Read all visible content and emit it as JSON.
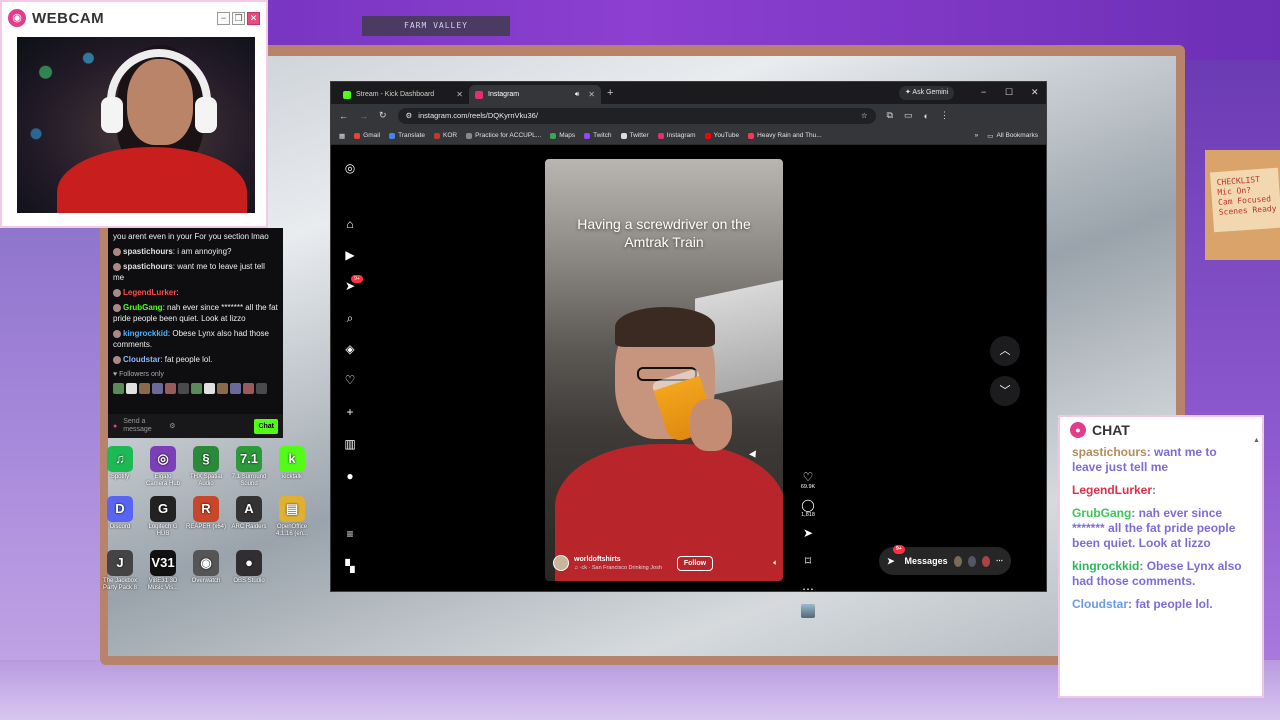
{
  "scene": {
    "sign": "FARM VALLEY",
    "sticky_note": "CHECKLIST\nMic On?\nCam Focused\nScenes Ready"
  },
  "webcam": {
    "title": "WEBCAM",
    "minimize": "−",
    "maximize": "❐",
    "close": "✕"
  },
  "mini_chat": {
    "messages": [
      {
        "user": "",
        "text": "you arent even in your For you section lmao",
        "color": "#ffffff"
      },
      {
        "user": "spastichours",
        "text": ": i am annoying?",
        "color": "#e0e0e0"
      },
      {
        "user": "spastichours",
        "text": ": want me to leave just tell me",
        "color": "#e0e0e0"
      },
      {
        "user": "LegendLurker",
        "text": ":",
        "color": "#ff4a4a"
      },
      {
        "user": "GrubGang",
        "text": ": nah ever since ******* all the fat pride people been quiet. Look at lizzo",
        "color": "#53fc18"
      },
      {
        "user": "kingrockkid",
        "text": ": Obese Lynx also had those comments.",
        "color": "#4ab0ff"
      },
      {
        "user": "Cloudstar",
        "text": ": fat people lol.",
        "color": "#8fb6ff"
      }
    ],
    "followers_only": "♥ Followers only",
    "input_placeholder": "Send a message",
    "chat_button": "Chat"
  },
  "desktop_icons": [
    {
      "label": "Spotify",
      "glyph": "♫",
      "color": "#1db954"
    },
    {
      "label": "Elgato Camera Hub",
      "glyph": "◎",
      "color": "#7b3fb8"
    },
    {
      "label": "THX Spatial Audio",
      "glyph": "§",
      "color": "#2a8a3a"
    },
    {
      "label": "7.1 Surround Sound",
      "glyph": "7.1",
      "color": "#2a9a3a"
    },
    {
      "label": "kicktalk",
      "glyph": "k",
      "color": "#53fc18"
    },
    {
      "label": "Discord",
      "glyph": "D",
      "color": "#5865f2"
    },
    {
      "label": "Logitech G HUB",
      "glyph": "G",
      "color": "#222222"
    },
    {
      "label": "REAPER (x64)",
      "glyph": "R",
      "color": "#c8462a"
    },
    {
      "label": "ARC Raiders",
      "glyph": "A",
      "color": "#333333"
    },
    {
      "label": "OpenOffice 4.1.16 (en...",
      "glyph": "▤",
      "color": "#e0b030"
    },
    {
      "label": "The Jackbox Party Pack 8",
      "glyph": "J",
      "color": "#444444"
    },
    {
      "label": "Vi8E31 3D Music Vis...",
      "glyph": "V31",
      "color": "#111111"
    },
    {
      "label": "Overwatch",
      "glyph": "◉",
      "color": "#555555"
    },
    {
      "label": "OBS Studio",
      "glyph": "●",
      "color": "#302e31"
    }
  ],
  "browser": {
    "tabs": [
      {
        "label": "Stream - Kick Dashboard",
        "favicon_color": "#53fc18",
        "active": false
      },
      {
        "label": "Instagram",
        "favicon_color": "#e1306c",
        "active": true
      }
    ],
    "new_tab": "+",
    "ask_gemini": "✦ Ask Gemini",
    "url": "instagram.com/reels/DQKyrnVku36/",
    "bookmarks": [
      {
        "label": "Gmail",
        "color": "#ea4335"
      },
      {
        "label": "Translate",
        "color": "#4285f4"
      },
      {
        "label": "KOR",
        "color": "#c0392b"
      },
      {
        "label": "Practice for ACCUPL...",
        "color": "#888888"
      },
      {
        "label": "Maps",
        "color": "#34a853"
      },
      {
        "label": "Twitch",
        "color": "#9146ff"
      },
      {
        "label": "Twitter",
        "color": "#dddddd"
      },
      {
        "label": "Instagram",
        "color": "#e1306c"
      },
      {
        "label": "YouTube",
        "color": "#ff0000"
      },
      {
        "label": "Heavy Rain and Thu...",
        "color": "#ff3355"
      }
    ],
    "all_bookmarks": "All Bookmarks"
  },
  "instagram": {
    "nav_badge": "9+",
    "reel": {
      "caption": "Having a screwdriver on the Amtrak Train",
      "username": "worldoftshirts",
      "song": "♫ ·ck · San Francisco Drinking  Josh",
      "follow": "Follow",
      "likes": "69.9K",
      "comments": "1,818"
    },
    "messages_label": "Messages",
    "messages_badge": "9+"
  },
  "chat": {
    "title": "CHAT",
    "messages": [
      {
        "user": "spastichours",
        "text": ": want me to leave just tell me",
        "color": "#b58a5a"
      },
      {
        "user": "LegendLurker",
        "text": ":",
        "color": "#e0304a"
      },
      {
        "user": "GrubGang",
        "text": ": nah ever since ******* all the fat pride people been quiet. Look at lizzo",
        "color": "#3cc85a"
      },
      {
        "user": "kingrockkid",
        "text": ": Obese Lynx also had those comments.",
        "color": "#2ab85a"
      },
      {
        "user": "Cloudstar",
        "text": ": fat people lol.",
        "color": "#6a9ae8"
      }
    ]
  }
}
